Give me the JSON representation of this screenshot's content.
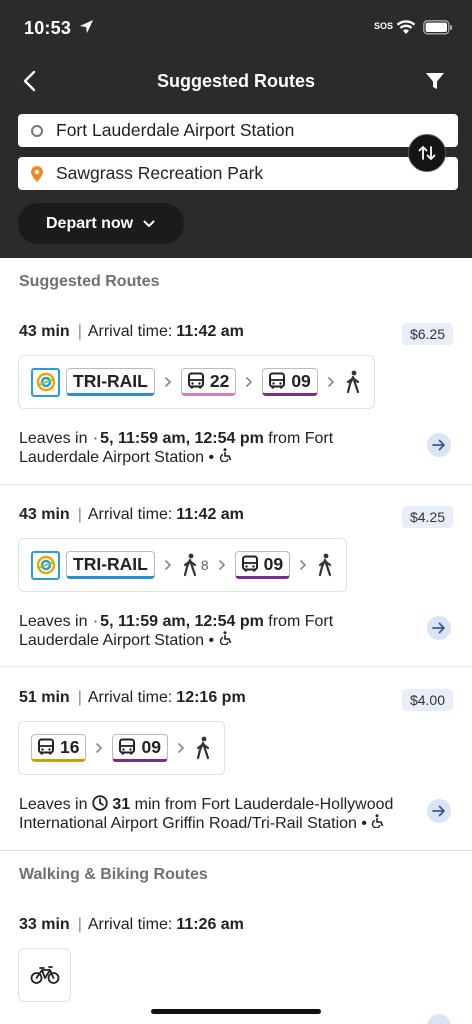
{
  "status": {
    "time": "10:53",
    "sos": "SOS"
  },
  "nav": {
    "title": "Suggested Routes"
  },
  "trip": {
    "origin": "Fort Lauderdale Airport Station",
    "destination": "Sawgrass Recreation Park",
    "depart_label": "Depart now"
  },
  "sections": {
    "suggested": "Suggested Routes",
    "walking": "Walking & Biking Routes"
  },
  "labels": {
    "arrival": "Arrival time:",
    "leaves_in": "Leaves in",
    "from": "from Fort",
    "bullet": "•"
  },
  "routes": [
    {
      "duration": "43 min",
      "arrival": "11:42 am",
      "price": "$6.25",
      "legs": {
        "train": "TRI-RAIL",
        "bus1": "22",
        "bus2": "09"
      },
      "leaves_line1_a": "5, 11:59 am, 12:54 pm",
      "leaves_line2": "Lauderdale Airport Station"
    },
    {
      "duration": "43 min",
      "arrival": "11:42 am",
      "price": "$4.25",
      "legs": {
        "train": "TRI-RAIL",
        "walk_count": "8",
        "bus": "09"
      },
      "leaves_line1_a": "5, 11:59 am, 12:54 pm",
      "leaves_line2": "Lauderdale Airport Station"
    },
    {
      "duration": "51 min",
      "arrival": "12:16 pm",
      "price": "$4.00",
      "legs": {
        "bus1": "16",
        "bus2": "09"
      },
      "leaves_mins": "31",
      "leaves_line1_b": "min from Fort Lauderdale-Hollywood",
      "leaves_line2": "International Airport Griffin Road/Tri-Rail Station"
    }
  ],
  "walking_route": {
    "duration": "33 min",
    "arrival": "11:26 am"
  },
  "colors": {
    "header_bg": "#2b2b2d",
    "trirail": "#2a8fd1",
    "bus22": "#d47cc5",
    "bus09": "#7b2b8c",
    "bus16": "#c9a400",
    "realtime": "#18a05a",
    "price_bg": "#e7eef7"
  },
  "icons": [
    "location-arrow-icon",
    "wifi-icon",
    "battery-icon",
    "back-chevron-icon",
    "filter-icon",
    "origin-ring-icon",
    "destination-pin-icon",
    "swap-icon",
    "chevron-down-icon",
    "tri-rail-logo-icon",
    "bus-icon",
    "walk-icon",
    "realtime-icon",
    "wheelchair-icon",
    "arrow-right-icon",
    "clock-icon",
    "bicycle-icon"
  ]
}
